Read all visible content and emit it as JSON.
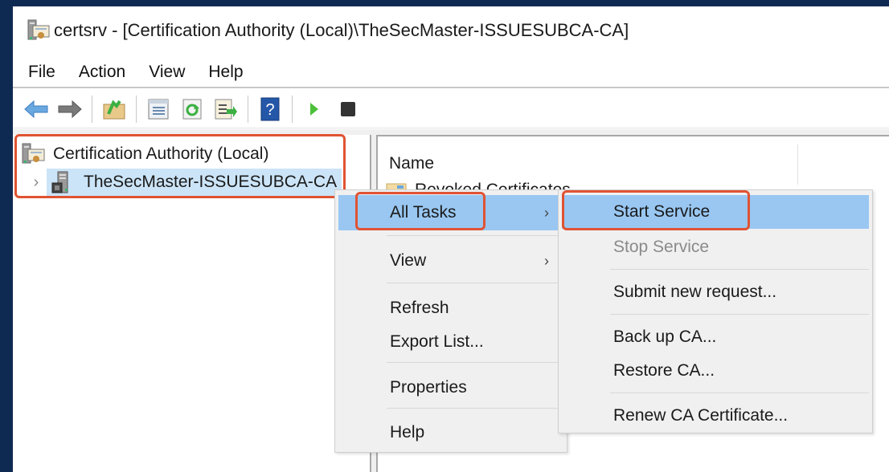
{
  "window": {
    "title": "certsrv - [Certification Authority (Local)\\TheSecMaster-ISSUESUBCA-CA]",
    "app_icon": "certificate-authority-icon"
  },
  "menubar": {
    "items": [
      {
        "label": "File"
      },
      {
        "label": "Action"
      },
      {
        "label": "View"
      },
      {
        "label": "Help"
      }
    ]
  },
  "toolbar": {
    "buttons": [
      {
        "name": "back",
        "icon": "back-arrow-icon"
      },
      {
        "name": "forward",
        "icon": "forward-arrow-icon"
      },
      {
        "name": "up-one-level",
        "icon": "folder-up-icon"
      },
      {
        "name": "show-hide-console-tree",
        "icon": "console-tree-icon"
      },
      {
        "name": "refresh",
        "icon": "refresh-icon"
      },
      {
        "name": "export-list",
        "icon": "export-list-icon"
      },
      {
        "name": "help",
        "icon": "help-icon"
      },
      {
        "name": "start-service",
        "icon": "play-icon"
      },
      {
        "name": "stop-service",
        "icon": "stop-icon"
      }
    ]
  },
  "tree": {
    "root": {
      "label": "Certification Authority (Local)",
      "icon": "certificate-authority-icon"
    },
    "child": {
      "label": "TheSecMaster-ISSUESUBCA-CA",
      "icon": "server-icon",
      "expander": "›",
      "selected": true
    }
  },
  "list": {
    "column_header": "Name",
    "rows": [
      {
        "label": "Revoked Certificates",
        "icon": "folder-icon"
      }
    ]
  },
  "context_menu": {
    "items": [
      {
        "label": "All Tasks",
        "submenu": true,
        "highlighted": true
      },
      {
        "label": "View",
        "submenu": true
      },
      {
        "label": "Refresh"
      },
      {
        "label": "Export List..."
      },
      {
        "label": "Properties"
      },
      {
        "label": "Help"
      }
    ],
    "submenu_arrow": "›"
  },
  "submenu": {
    "items": [
      {
        "label": "Start Service",
        "highlighted": true
      },
      {
        "label": "Stop Service",
        "disabled": true
      },
      {
        "label": "Submit new request..."
      },
      {
        "label": "Back up CA..."
      },
      {
        "label": "Restore CA..."
      },
      {
        "label": "Renew CA Certificate..."
      }
    ]
  },
  "colors": {
    "highlight_border": "#e05333",
    "menu_hover": "#99c7f2",
    "tree_selection": "#cce4f7",
    "desktop": "#0f2a52"
  }
}
